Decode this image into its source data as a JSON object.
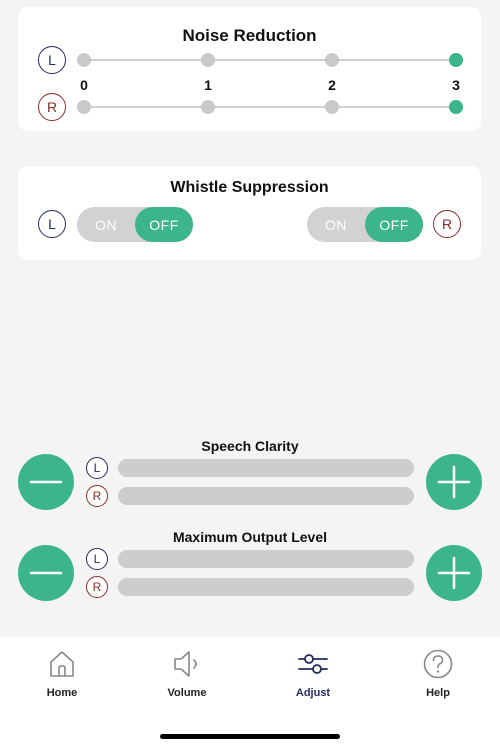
{
  "noise_reduction": {
    "title": "Noise Reduction",
    "left_badge": "L",
    "right_badge": "R",
    "levels": [
      "0",
      "1",
      "2",
      "3"
    ],
    "left_level": 3,
    "right_level": 3
  },
  "whistle_suppression": {
    "title": "Whistle Suppression",
    "left_badge": "L",
    "right_badge": "R",
    "left": {
      "on_label": "ON",
      "off_label": "OFF",
      "selected": "OFF"
    },
    "right": {
      "on_label": "ON",
      "off_label": "OFF",
      "selected": "OFF"
    }
  },
  "speech_clarity": {
    "title": "Speech Clarity",
    "left_badge": "L",
    "right_badge": "R"
  },
  "max_output": {
    "title": "Maximum Output Level",
    "left_badge": "L",
    "right_badge": "R"
  },
  "tabbar": {
    "home": "Home",
    "volume": "Volume",
    "adjust": "Adjust",
    "help": "Help",
    "selected": "Adjust"
  },
  "colors": {
    "accent": "#3db58a",
    "left_ear": "#232a5c",
    "right_ear": "#8a2b25",
    "inactive": "#c9c9c9"
  }
}
